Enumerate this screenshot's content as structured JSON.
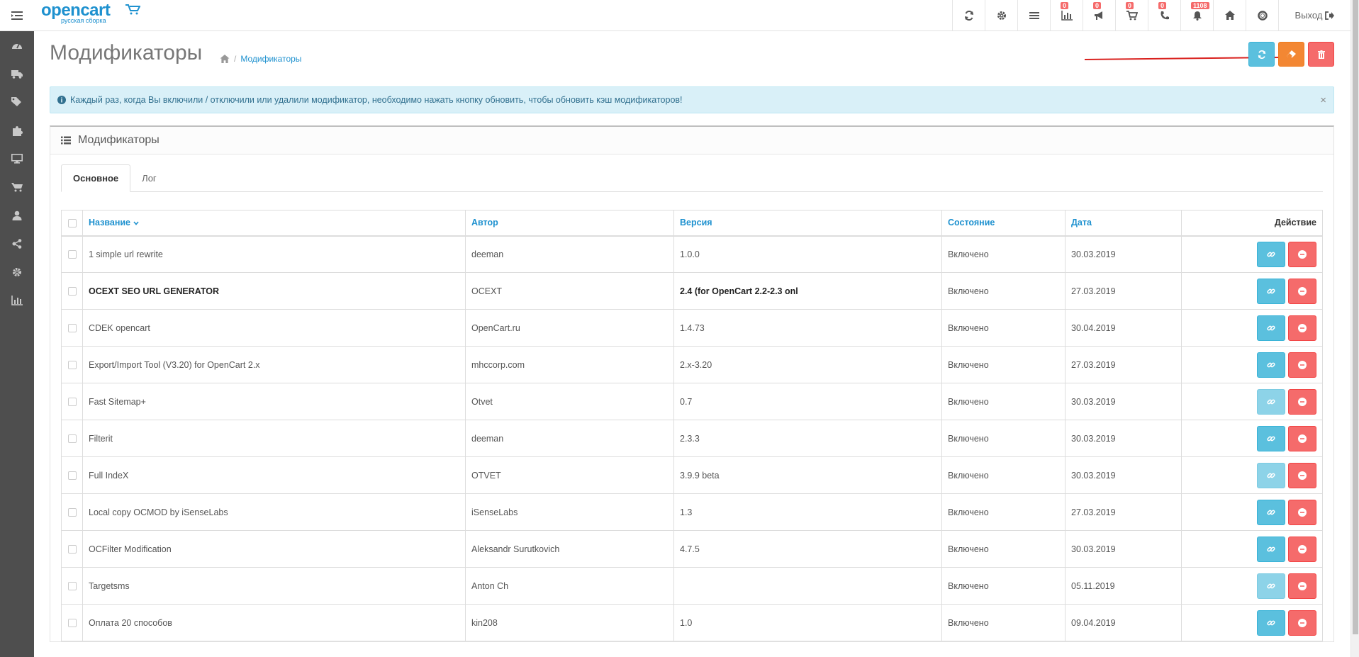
{
  "header": {
    "logo_text": "opencart",
    "logo_sub": "русская сборка",
    "badges": [
      "0",
      "0",
      "0",
      "0",
      "1108"
    ],
    "logout_label": "Выход"
  },
  "page": {
    "title": "Модификаторы",
    "breadcrumb": "Модификаторы"
  },
  "alert": {
    "text": "Каждый раз, когда Вы включили / отключили или удалили модификатор, необходимо нажать кнопку обновить, чтобы обновить кэш модификаторов!",
    "close": "×"
  },
  "panel": {
    "title": "Модификаторы",
    "tabs": [
      "Основное",
      "Лог"
    ]
  },
  "table": {
    "columns": [
      "Название",
      "Автор",
      "Версия",
      "Состояние",
      "Дата",
      "Действие"
    ],
    "rows": [
      {
        "name": "1 simple url rewrite",
        "author": "deeman",
        "version": "1.0.0",
        "status": "Включено",
        "date": "30.03.2019",
        "link_enabled": true,
        "bold": false
      },
      {
        "name": "OCEXT SEO URL GENERATOR",
        "author": "OCEXT",
        "version": "2.4 (for OpenCart 2.2-2.3 onl",
        "status": "Включено",
        "date": "27.03.2019",
        "link_enabled": true,
        "bold": true
      },
      {
        "name": "CDEK opencart",
        "author": "OpenCart.ru",
        "version": "1.4.73",
        "status": "Включено",
        "date": "30.04.2019",
        "link_enabled": true,
        "bold": false
      },
      {
        "name": "Export/Import Tool (V3.20) for OpenCart 2.x",
        "author": "mhccorp.com",
        "version": "2.x-3.20",
        "status": "Включено",
        "date": "27.03.2019",
        "link_enabled": true,
        "bold": false
      },
      {
        "name": "Fast Sitemap+",
        "author": "Otvet",
        "version": "0.7",
        "status": "Включено",
        "date": "30.03.2019",
        "link_enabled": false,
        "bold": false
      },
      {
        "name": "Filterit",
        "author": "deeman",
        "version": "2.3.3",
        "status": "Включено",
        "date": "30.03.2019",
        "link_enabled": true,
        "bold": false
      },
      {
        "name": "Full IndeX",
        "author": "OTVET",
        "version": "3.9.9 beta",
        "status": "Включено",
        "date": "30.03.2019",
        "link_enabled": false,
        "bold": false
      },
      {
        "name": "Local copy OCMOD by iSenseLabs",
        "author": "iSenseLabs",
        "version": "1.3",
        "status": "Включено",
        "date": "27.03.2019",
        "link_enabled": true,
        "bold": false
      },
      {
        "name": "OCFilter Modification",
        "author": "Aleksandr Surutkovich",
        "version": "4.7.5",
        "status": "Включено",
        "date": "30.03.2019",
        "link_enabled": true,
        "bold": false
      },
      {
        "name": "Targetsms",
        "author": "Anton Ch",
        "version": "",
        "status": "Включено",
        "date": "05.11.2019",
        "link_enabled": false,
        "bold": false
      },
      {
        "name": "Оплата 20 способов",
        "author": "kin208",
        "version": "1.0",
        "status": "Включено",
        "date": "09.04.2019",
        "link_enabled": true,
        "bold": false
      }
    ]
  },
  "colors": {
    "info": "#5bc0de",
    "warning": "#f38733",
    "danger": "#f56b6b",
    "brand": "#1e91cf",
    "sidebar": "#4e4e4e"
  }
}
